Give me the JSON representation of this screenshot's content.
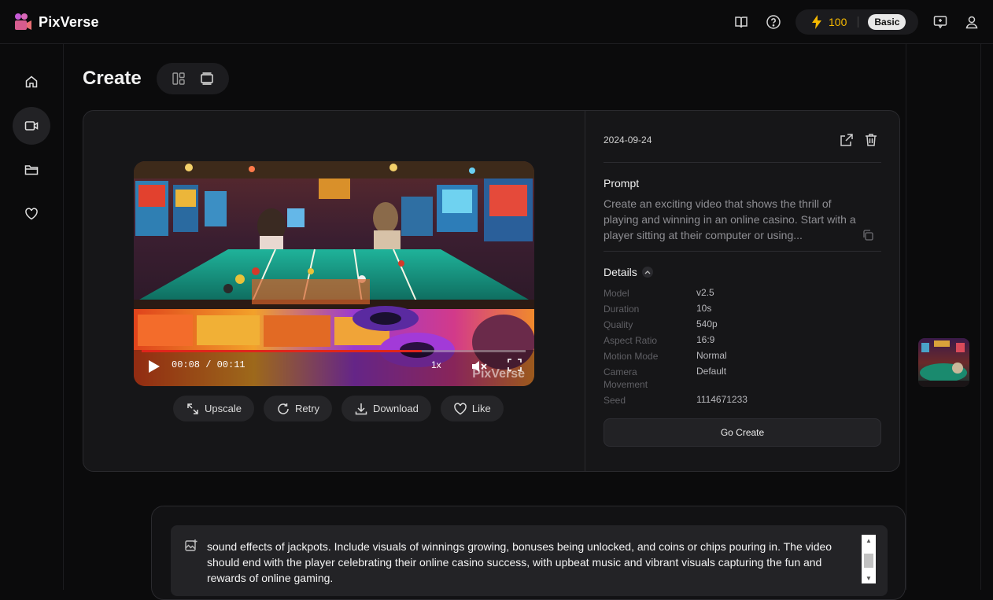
{
  "app": {
    "name": "PixVerse"
  },
  "header": {
    "credits": "100",
    "plan": "Basic",
    "icons": [
      "book-icon",
      "help-icon",
      "bolt-icon",
      "feedback-icon",
      "user-icon"
    ]
  },
  "sidebar": {
    "items": [
      {
        "name": "home",
        "icon": "home-icon",
        "active": false
      },
      {
        "name": "create",
        "icon": "video-icon",
        "active": true
      },
      {
        "name": "assets",
        "icon": "folder-icon",
        "active": false
      },
      {
        "name": "favorites",
        "icon": "heart-icon",
        "active": false
      }
    ]
  },
  "page": {
    "title": "Create"
  },
  "video": {
    "time": "00:08 / 00:11",
    "progress": 0.73,
    "speed": "1x",
    "watermark": "PixVerse"
  },
  "actions": {
    "upscale": "Upscale",
    "retry": "Retry",
    "download": "Download",
    "like": "Like"
  },
  "details_panel": {
    "date": "2024-09-24",
    "prompt_title": "Prompt",
    "prompt_text": "Create an exciting video that shows the thrill of playing and winning in an online casino. Start with a player sitting at their computer or using...",
    "details_title": "Details",
    "rows": [
      {
        "key": "Model",
        "value": "v2.5"
      },
      {
        "key": "Duration",
        "value": "10s"
      },
      {
        "key": "Quality",
        "value": "540p"
      },
      {
        "key": "Aspect Ratio",
        "value": "16:9"
      },
      {
        "key": "Motion Mode",
        "value": "Normal"
      },
      {
        "key": "Camera Movement",
        "value": "Default"
      },
      {
        "key": "Seed",
        "value": "1114671233"
      }
    ],
    "go_create": "Go Create"
  },
  "composer": {
    "text": "sound effects of jackpots. Include visuals of winnings growing, bonuses being unlocked, and coins or chips pouring in. The video should end with the player celebrating their online casino success, with upbeat music and vibrant visuals capturing the fun and rewards of online gaming."
  },
  "colors": {
    "accent": "#f5b800",
    "progress": "#e0251b",
    "background": "#0b0b0c",
    "card": "#161618"
  }
}
